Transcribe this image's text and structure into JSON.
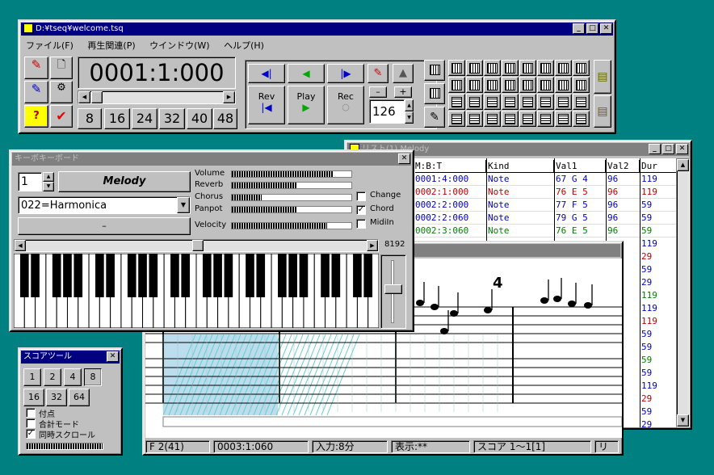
{
  "main": {
    "title": "D:¥tseq¥welcome.tsq",
    "menu": [
      "ファイル(F)",
      "再生関連(P)",
      "ウインドウ(W)",
      "ヘルプ(H)"
    ],
    "time": "0001:1:000",
    "quant": [
      "8",
      "16",
      "24",
      "32",
      "40",
      "48"
    ],
    "rev": "Rev",
    "play": "Play",
    "rec": "Rec",
    "tempo": "126",
    "minus": "–",
    "plus": "+"
  },
  "list": {
    "title": "リスト(1) Melody",
    "headers": [
      "M:B:T",
      "Kind",
      "Val1",
      "Val2",
      "Dur"
    ],
    "rows": [
      {
        "mbt": "0001:4:000",
        "kind": "Note",
        "v1": "67  G 4",
        "v2": "96",
        "dur": "119",
        "color": "#0000c0"
      },
      {
        "mbt": "0002:1:000",
        "kind": "Note",
        "v1": "76  E 5",
        "v2": "96",
        "dur": "119",
        "color": "#c00000"
      },
      {
        "mbt": "0002:2:000",
        "kind": "Note",
        "v1": "77  F 5",
        "v2": "96",
        "dur": "59",
        "color": "#0000c0"
      },
      {
        "mbt": "0002:2:060",
        "kind": "Note",
        "v1": "79  G 5",
        "v2": "96",
        "dur": "59",
        "color": "#0000c0"
      },
      {
        "mbt": "0002:3:060",
        "kind": "Note",
        "v1": "76  E 5",
        "v2": "96",
        "dur": "59",
        "color": "#008000"
      }
    ],
    "dur_extra": [
      {
        "v": "119",
        "color": "#0000c0"
      },
      {
        "v": "29",
        "color": "#c00000"
      },
      {
        "v": "59",
        "color": "#0000c0"
      },
      {
        "v": "29",
        "color": "#0000c0"
      },
      {
        "v": "119",
        "color": "#008000"
      },
      {
        "v": "119",
        "color": "#0000c0"
      },
      {
        "v": "119",
        "color": "#c00000"
      },
      {
        "v": "59",
        "color": "#0000c0"
      },
      {
        "v": "59",
        "color": "#0000c0"
      },
      {
        "v": "59",
        "color": "#008000"
      },
      {
        "v": "59",
        "color": "#0000c0"
      },
      {
        "v": "119",
        "color": "#0000c0"
      },
      {
        "v": "29",
        "color": "#c00000"
      },
      {
        "v": "59",
        "color": "#0000c0"
      },
      {
        "v": "29",
        "color": "#0000c0"
      }
    ]
  },
  "score": {
    "measure_number": "4",
    "status": [
      "F 2(41)",
      "0003:1:060",
      "入力:8分",
      "表示:**",
      "スコア 1〜1[1]",
      "リ"
    ]
  },
  "keyboard": {
    "title": "キーボキーボード",
    "channel": "1",
    "melody": "Melody",
    "program": "022=Harmonica",
    "dash": "–",
    "sliders": [
      {
        "label": "Volume",
        "level": 0.85
      },
      {
        "label": "Reverb",
        "level": 0.55
      },
      {
        "label": "Chorus",
        "level": 0.25
      },
      {
        "label": "Panpot",
        "level": 0.55
      },
      {
        "label": "Velocity",
        "level": 0.8
      }
    ],
    "checks": [
      {
        "label": "Change",
        "checked": false
      },
      {
        "label": "Chord",
        "checked": true
      },
      {
        "label": "MidiIn",
        "checked": false
      }
    ],
    "bend": "8192"
  },
  "scoretool": {
    "title": "スコアツール",
    "row1": [
      "1",
      "2",
      "4",
      "8"
    ],
    "row2": [
      "16",
      "32",
      "64"
    ],
    "checks": [
      {
        "label": "付点",
        "checked": false
      },
      {
        "label": "合計モード",
        "checked": false
      },
      {
        "label": "同時スクロール",
        "checked": true
      }
    ]
  }
}
